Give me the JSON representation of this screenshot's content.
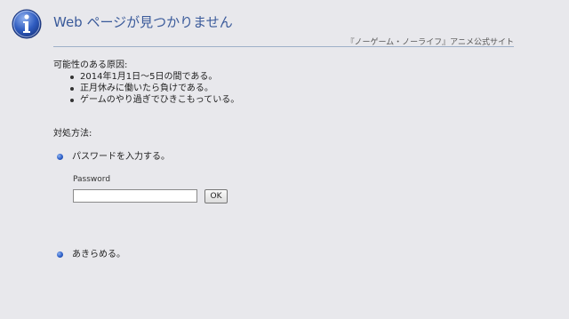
{
  "header": {
    "title": "Web ページが見つかりません",
    "site_link": "『ノーゲーム・ノーライフ』アニメ公式サイト",
    "icon": "info-icon"
  },
  "causes": {
    "heading": "可能性のある原因:",
    "items": [
      "2014年1月1日～5日の間である。",
      "正月休みに働いたら負けである。",
      "ゲームのやり過ぎでひきこもっている。"
    ]
  },
  "remedies": {
    "heading": "対処方法:",
    "password_option": "パスワードを入力する。",
    "password_label": "Password",
    "password_value": "",
    "ok_label": "OK",
    "giveup_option": "あきらめる。"
  },
  "colors": {
    "background": "#e8e8ec",
    "title": "#3a5a9a",
    "bullet": "#2d5fc8"
  }
}
